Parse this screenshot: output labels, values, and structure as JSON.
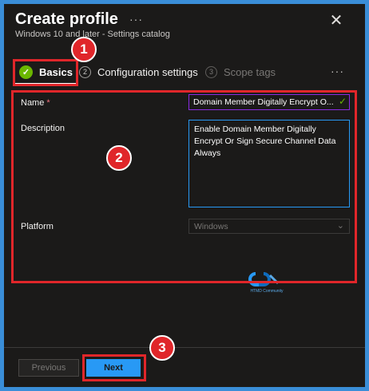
{
  "header": {
    "title": "Create profile",
    "more": "···",
    "close": "✕",
    "subtitle": "Windows 10 and later - Settings catalog"
  },
  "tabs": [
    {
      "step": "✓",
      "label": "Basics",
      "state": "active"
    },
    {
      "step": "2",
      "label": "Configuration settings",
      "state": "upcoming"
    },
    {
      "step": "3",
      "label": "Scope tags",
      "state": "disabled"
    }
  ],
  "tabs_more": "···",
  "form": {
    "name_label": "Name",
    "required_mark": "*",
    "name_value": "Domain Member Digitally Encrypt O...",
    "name_valid_icon": "✓",
    "description_label": "Description",
    "description_value": "Enable Domain Member Digitally Encrypt Or Sign Secure Channel Data Always",
    "platform_label": "Platform",
    "platform_value": "Windows",
    "platform_chevron": "⌄"
  },
  "watermark": {
    "text": "HTMD Community",
    "icon": "htmd-logo-icon"
  },
  "footer": {
    "previous_label": "Previous",
    "next_label": "Next"
  },
  "annotations": [
    "1",
    "2",
    "3"
  ],
  "colors": {
    "background": "#3a8ed8",
    "panel": "#1b1a19",
    "accent": "#2899f5",
    "success": "#6bb700",
    "annotation": "#e0262a",
    "name_border": "#8a2be2"
  }
}
